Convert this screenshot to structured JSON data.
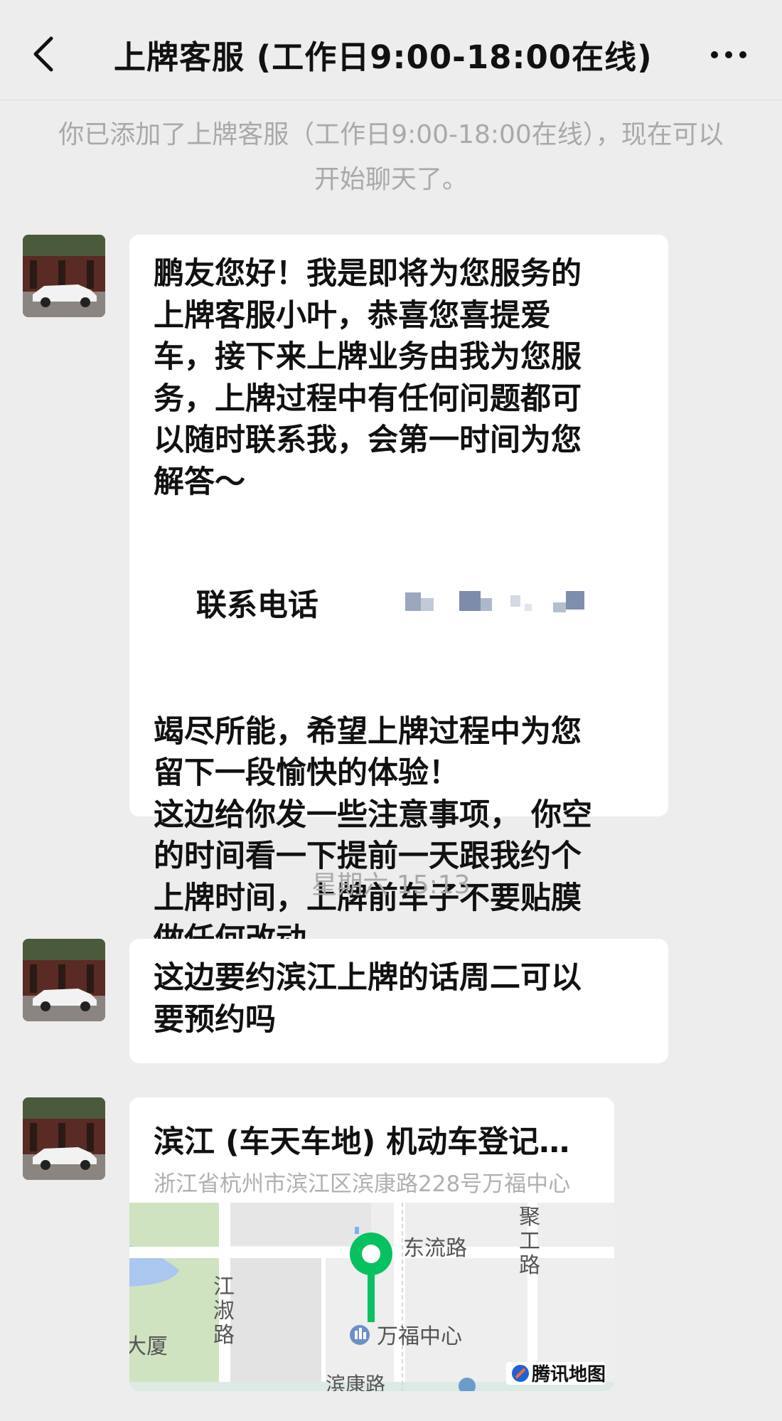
{
  "header": {
    "title": "上牌客服 (工作日9:00-18:00在线)"
  },
  "system_notice": "你已添加了上牌客服（工作日9:00-18:00在线），现在可以开始聊天了。",
  "messages": [
    {
      "type": "text",
      "text": "鹏友您好！我是即将为您服务的\n上牌客服小叶，恭喜您喜提爱\n车，接下来上牌业务由我为您服\n务，上牌过程中有任何问题都可\n以随时联系我，会第一时间为您\n解答～"
    },
    {
      "phone_label": "联系电话"
    },
    {
      "type": "text",
      "text": "竭尽所能，希望上牌过程中为您\n留下一段愉快的体验！\n这边给你发一些注意事项， 你空\n的时间看一下提前一天跟我约个\n上牌时间，上牌前车子不要贴膜\n做任何改动。"
    }
  ],
  "timestamp": "星期六 15:13",
  "message2": {
    "text": "这边要约滨江上牌的话周二可以\n要预约吗"
  },
  "location": {
    "name": "滨江 (车天车地) 机动车登记服务站",
    "address": "浙江省杭州市滨江区滨康路228号万福中心",
    "map_labels": {
      "road1": "东流路",
      "road2": "聚工路",
      "road3": "江淑路",
      "road4": "滨康路",
      "poi": "万福中心",
      "building": "大厦",
      "brand": "腾讯地图"
    }
  },
  "colors": {
    "background": "#ededed",
    "bubble": "#ffffff",
    "pin": "#07c160",
    "muted": "#a9a9a9"
  }
}
